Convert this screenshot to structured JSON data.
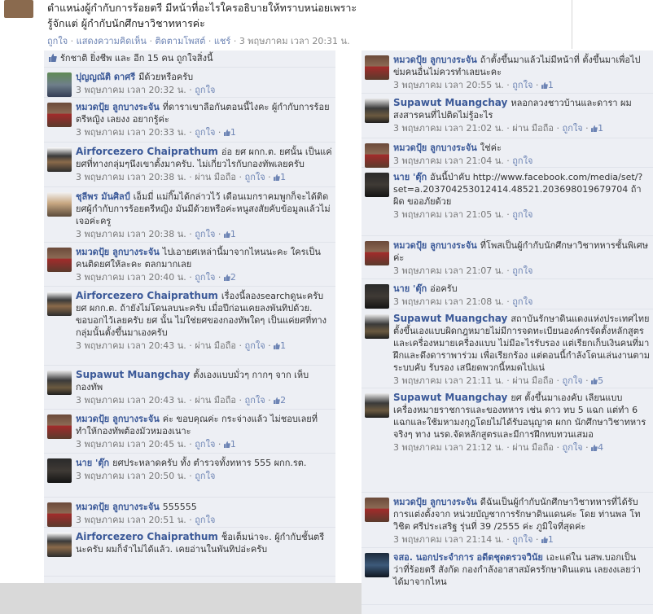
{
  "post": {
    "text": "ตำแหน่งผู้กำกับการร้อยตรี มีหน้าที่อะไรใครอธิบายให้ทราบหน่อยเพราะรู้จักแต่ ผู้กำกับนักศึกษาวิชาทหารค่ะ",
    "like": "ถูกใจ",
    "comment": "แสดงความคิดเห็น",
    "follow": "ติดตามโพสต์",
    "share": "แชร์",
    "time": "3 พฤษภาคม เวลา 20:31 น."
  },
  "likes_bar": {
    "text": "รักชาติ ยิ่งชีพ และ อีก 15 คน ถูกใจสิ่งนี้"
  },
  "left_comments": [
    {
      "name": "ปุญญณัติ ดาศรี",
      "text": "มีด้วยหรือครับ",
      "time": "3 พฤษภาคม เวลา 20:32 น.",
      "mobile": "",
      "like": "ถูกใจ",
      "count": "",
      "h": 37,
      "big": false,
      "av": "a3"
    },
    {
      "name": "หมวดปุ้ย ลูกบางระจัน",
      "text": "ที่ดาราเขาลือกันตอนนี้ไงคะ ผู้กำกับการร้อยตรีหญิง เลยงง อยากรู้ค่ะ",
      "time": "3 พฤษภาคม เวลา 20:33 น.",
      "mobile": "",
      "like": "ถูกใจ",
      "count": "1",
      "h": 55,
      "big": false,
      "av": "a1"
    },
    {
      "name": "Airforcezero Chaiprathum",
      "text": "อ่อ ยศ ผกก.ต. ยศนั้น เป็นแค่ยศที่ทางกลุ่มๆนึงเขาตั้งมาครับ. ไม่เกี่ยวไรกับกองทัพเลยครับ",
      "time": "3 พฤษภาคม เวลา 20:38 น.",
      "mobile": "ผ่าน มือถือ",
      "like": "ถูกใจ",
      "count": "1",
      "h": 55,
      "big": true,
      "av": "a2"
    },
    {
      "name": "ชุลีพร มันศิลป์",
      "text": "เอ็มมี่ แม่กิ๊มได้กล่าวไว้ เดือนเมกราคมพูกก็จะได้ติดยศผู้กำกับการร้อยตรีหญิง มันมีด้วยหรือค่ะหนูสงสัยคับข้อมูลแล้วไม่เจอค่ะครู",
      "time": "3 พฤษภาคม เวลา 20:38 น.",
      "mobile": "",
      "like": "ถูกใจ",
      "count": "1",
      "h": 68,
      "big": false,
      "av": "a4"
    },
    {
      "name": "หมวดปุ้ย ลูกบางระจัน",
      "text": "ไปเอายศเหล่านี้มาจากไหนนะคะ ใครเป็นคนติดยศให้ละคะ ตลกมากเลย",
      "time": "3 พฤษภาคม เวลา 20:40 น.",
      "mobile": "",
      "like": "ถูกใจ",
      "count": "2",
      "h": 54,
      "big": false,
      "av": "a1"
    },
    {
      "name": "Airforcezero Chaiprathum",
      "text": "เรื่องนี้ลองsearchดูนะครับ ยศ ผกก.ต. ถ้ายังไม่โดนลบนะครับ เมื่อปีก่อนเคยลงพันทิปด้วย. ขอบอกไว้เลยครับ ยศ นั้น ไม่ใช่ยศของกองทัพใดๆ เป็นแค่ยศที่ทางกลุ่มนั้นตั้งขึ้นมาเองครับ",
      "time": "3 พฤษภาคม เวลา 20:43 น.",
      "mobile": "ผ่าน มือถือ",
      "like": "ถูกใจ",
      "count": "1",
      "h": 97,
      "big": true,
      "av": "a2"
    },
    {
      "name": "Supawut Muangchay",
      "text": "ตั้งเองแบบมั่วๆ กากๆ จาก เห็บกองทัพ",
      "time": "3 พฤษภาคม เวลา 20:43 น.",
      "mobile": "ผ่าน มือถือ",
      "like": "ถูกใจ",
      "count": "2",
      "h": 54,
      "big": true,
      "av": "a5"
    },
    {
      "name": "หมวดปุ้ย ลูกบางระจัน",
      "text": "ค่ะ ขอบคุณค่ะ กระจ่างแล้ว ไม่ชอบเลยที่ทำให้กองทัพต้องมัวหมองเนาะ",
      "time": "3 พฤษภาคม เวลา 20:45 น.",
      "mobile": "",
      "like": "ถูกใจ",
      "count": "1",
      "h": 54,
      "big": false,
      "av": "a1"
    },
    {
      "name": "นาย 'ตุ๊ก",
      "text": "ยศประหลาดครับ ทั้ง ตำรวจทั้งทหาร 555 ผกก.รต.",
      "time": "3 พฤษภาคม เวลา 20:50 น.",
      "mobile": "",
      "like": "ถูกใจ",
      "count": "",
      "h": 54,
      "big": false,
      "av": "a6"
    },
    {
      "name": "หมวดปุ้ย ลูกบางระจัน",
      "text": "555555",
      "time": "3 พฤษภาคม เวลา 20:51 น.",
      "mobile": "",
      "like": "ถูกใจ",
      "count": "",
      "h": 37,
      "big": false,
      "av": "a1"
    },
    {
      "name": "Airforcezero Chaiprathum",
      "text": "ช็อเต็มน่าจะ. ผู้กำกับชั้นตรีนะครับ ผมก็จำไม่ได้แล้ว. เคยอ่านในพันทิปอ่ะครับ",
      "time": "",
      "mobile": "",
      "like": "",
      "count": "",
      "h": 60,
      "big": true,
      "av": "a2"
    }
  ],
  "right_comments": [
    {
      "name": "หมวดปุ้ย ลูกบางระจัน",
      "text": "ถ้าตั้งขึ้นมาแล้วไม่มีหน้าที่ ตั้งขึ้นมาเพื่อไปข่มคนอื่นไม่ควรทำเลยนะคะ",
      "time": "3 พฤษภาคม เวลา 20:55 น.",
      "mobile": "",
      "like": "ถูกใจ",
      "count": "1",
      "h": 53,
      "big": false,
      "av": "a1"
    },
    {
      "name": "Supawut Muangchay",
      "text": "หลอกลวงชาวบ้านและดารา ผมสงสารคนที่ไปติดไม่รู้อะไร",
      "time": "3 พฤษภาคม เวลา 21:02 น.",
      "mobile": "ผ่าน มือถือ",
      "like": "ถูกใจ",
      "count": "1",
      "h": 55,
      "big": true,
      "av": "a5"
    },
    {
      "name": "หมวดปุ้ย ลูกบางระจัน",
      "text": "ใช่ค่ะ",
      "time": "3 พฤษภาคม เวลา 21:04 น.",
      "mobile": "",
      "like": "ถูกใจ",
      "count": "",
      "h": 36,
      "big": false,
      "av": "a1"
    },
    {
      "name": "นาย 'ตุ๊ก",
      "text": "อันนี้ป่าคับ http://www.facebook.com/media/set/?set=a.203704253012414.48521.203698019679704 ถ้าผิด ขออภัยด้วย",
      "time": "3 พฤษภาคม เวลา 21:05 น.",
      "mobile": "",
      "like": "ถูกใจ",
      "count": "",
      "h": 84,
      "big": false,
      "av": "a6"
    },
    {
      "name": "หมวดปุ้ย ลูกบางระจัน",
      "text": "ที่โพสเป็นผู้กำกับนักศึกษาวิชาทหารชั้นพิเศษค่ะ",
      "time": "3 พฤษภาคม เวลา 21:07 น.",
      "mobile": "",
      "like": "ถูกใจ",
      "count": "",
      "h": 53,
      "big": false,
      "av": "a1"
    },
    {
      "name": "นาย 'ตุ๊ก",
      "text": "อ่อครับ",
      "time": "3 พฤษภาคม เวลา 21:08 น.",
      "mobile": "",
      "like": "ถูกใจ",
      "count": "",
      "h": 37,
      "big": false,
      "av": "a6"
    },
    {
      "name": "Supawut Muangchay",
      "text": "สถาบันรักษาดินแดงแห่งประเทศไทย ตั้งขึ้นเองแบบผิดกฎหมายไม่มีการจดทะเบียนองค์กรจัดตั้งหลักสูตรและเครื่องหมายเครื่องแบบ ไม่มีอะไรรับรอง แต่เรียกเก็บเงินคนที่มาฝึกและดึงดาราพาร่วม เพื่อเรียกร้อง แต่ตอนนี้กำลังโดนเล่นงานตามระบบคับ รับรอง เสนียดพวกนี้หมดไปแน่",
      "time": "3 พฤษภาคม เวลา 21:11 น.",
      "mobile": "ผ่าน มือถือ",
      "like": "ถูกใจ",
      "count": "5",
      "h": 97,
      "big": true,
      "av": "a5"
    },
    {
      "name": "Supawut Muangchay",
      "text": "ยศ ตั้งขึ้นมาเองคับ เลียนแบบเครื่องหมายราชการและของทหาร เช่น ดาว ทบ 5 แฉก แต่ทำ 6 แฉกและใช้มหามงกุฎโดยไม่ได้รับอนุญาต ผกก นักศึกษาวิชาทหารจริงๆ ทาง นรด.จัดหลักสูตรและมีการฝึกทบทวนเสมอ",
      "time": "3 พฤษภาคม เวลา 21:12 น.",
      "mobile": "ผ่าน มือถือ",
      "like": "ถูกใจ",
      "count": "4",
      "h": 128,
      "big": true,
      "av": "a5"
    },
    {
      "name": "หมวดปุ้ย ลูกบางระจัน",
      "text": "ดีฉันเป็นผู้กำกับนักศึกษาวิชาทหารที่ได้รับการแต่งตั้งจาก หน่วยบัญชาการรักษาดินแดนค่ะ โดย ท่านพล โทวิชิต ศรีประเสริฐ รุ่นที่ 39 /2555 ค่ะ ภูมิใจที่สุดค่ะ",
      "time": "3 พฤษภาคม เวลา 21:14 น.",
      "mobile": "",
      "like": "ถูกใจ",
      "count": "1",
      "h": 68,
      "big": false,
      "av": "a1"
    },
    {
      "name": "จสอ. นอกประจำการ อดีตชุดตรวจวินัย",
      "text": "เอะแต่ใน นสพ.บอกเป็นว่าที่ร้อยตรี สังกัด กองกำลังอาสาสมัครรักษาดินแดน เลยงงเลยว่าได้มาจากไหน",
      "time": "",
      "mobile": "",
      "like": "",
      "count": "",
      "h": 70,
      "big": false,
      "av": "a7"
    }
  ],
  "colors": {
    "link": "#3b5998",
    "panel": "#edeff4",
    "meta_link": "#6d84b4"
  },
  "icons": [
    "thumbs-up-icon",
    "small-like-icon",
    "avatar"
  ]
}
